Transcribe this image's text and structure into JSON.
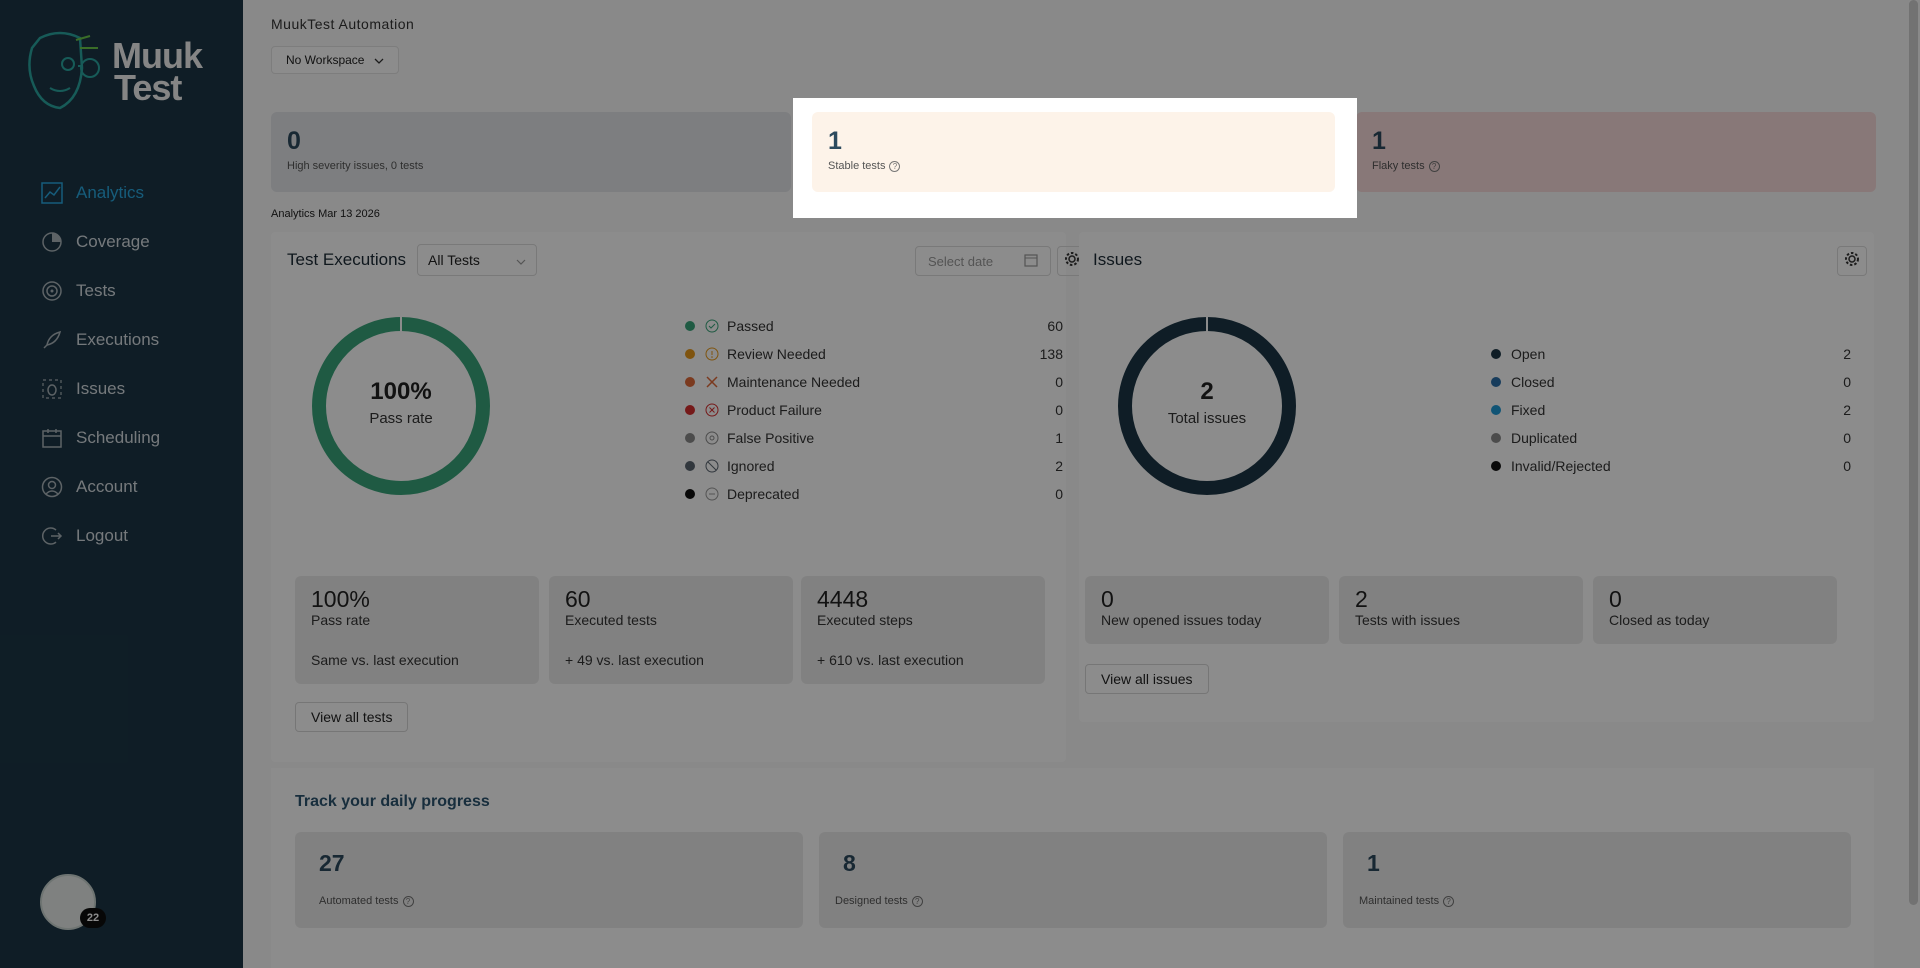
{
  "app": {
    "title": "MuukTest Automation",
    "workspace": "No Workspace"
  },
  "logo": {
    "text_line1": "Muuk",
    "text_line2": "Test"
  },
  "sidebar": {
    "items": [
      {
        "label": "Analytics",
        "icon": "chart-line-icon",
        "active": true
      },
      {
        "label": "Coverage",
        "icon": "coverage-icon"
      },
      {
        "label": "Tests",
        "icon": "target-icon"
      },
      {
        "label": "Executions",
        "icon": "rocket-icon"
      },
      {
        "label": "Issues",
        "icon": "bug-icon"
      },
      {
        "label": "Scheduling",
        "icon": "calendar-icon"
      },
      {
        "label": "Account",
        "icon": "user-icon"
      },
      {
        "label": "Logout",
        "icon": "logout-icon"
      }
    ],
    "avatar_badge": "22"
  },
  "summary": {
    "high": {
      "value": "0",
      "label": "High severity issues, 0 tests"
    },
    "stable": {
      "value": "1",
      "label": "Stable tests"
    },
    "flaky": {
      "value": "1",
      "label": "Flaky tests"
    }
  },
  "analytics_date": "Analytics Mar 13 2026",
  "executions": {
    "title": "Test Executions",
    "filter": "All Tests",
    "date_placeholder": "Select date",
    "donut": {
      "value": "100%",
      "label": "Pass rate",
      "color": "#3aa57a"
    },
    "legend": [
      {
        "label": "Passed",
        "value": "60",
        "color": "#3aa57a",
        "icon": "check-circle-icon"
      },
      {
        "label": "Review Needed",
        "value": "138",
        "color": "#e89a1c",
        "icon": "alert-circle-icon"
      },
      {
        "label": "Maintenance Needed",
        "value": "0",
        "color": "#e06a3a",
        "icon": "tools-icon"
      },
      {
        "label": "Product Failure",
        "value": "0",
        "color": "#d62e2e",
        "icon": "x-circle-icon"
      },
      {
        "label": "False Positive",
        "value": "1",
        "color": "#8a8a8a",
        "icon": "false-positive-icon"
      },
      {
        "label": "Ignored",
        "value": "2",
        "color": "#5a6470",
        "icon": "ban-icon"
      },
      {
        "label": "Deprecated",
        "value": "0",
        "color": "#111111",
        "icon": "minus-circle-icon"
      }
    ],
    "metrics": [
      {
        "value": "100%",
        "label": "Pass rate",
        "delta": "Same vs. last execution"
      },
      {
        "value": "60",
        "label": "Executed tests",
        "delta": "+ 49 vs. last execution"
      },
      {
        "value": "4448",
        "label": "Executed steps",
        "delta": "+ 610 vs. last execution"
      }
    ],
    "view_all": "View all tests"
  },
  "issues": {
    "title": "Issues",
    "donut": {
      "value": "2",
      "label": "Total issues",
      "color": "#1c3645"
    },
    "legend": [
      {
        "label": "Open",
        "value": "2",
        "color": "#1c3645"
      },
      {
        "label": "Closed",
        "value": "0",
        "color": "#2b6ea8"
      },
      {
        "label": "Fixed",
        "value": "2",
        "color": "#1e9ad6"
      },
      {
        "label": "Duplicated",
        "value": "0",
        "color": "#8a8a8a"
      },
      {
        "label": "Invalid/Rejected",
        "value": "0",
        "color": "#111111"
      }
    ],
    "metrics": [
      {
        "value": "0",
        "label": "New opened issues today"
      },
      {
        "value": "2",
        "label": "Tests with issues"
      },
      {
        "value": "0",
        "label": "Closed as today"
      }
    ],
    "view_all": "View all issues"
  },
  "progress": {
    "title": "Track your daily progress",
    "cards": [
      {
        "value": "27",
        "label": "Automated tests"
      },
      {
        "value": "8",
        "label": "Designed tests"
      },
      {
        "value": "1",
        "label": "Maintained tests"
      }
    ]
  }
}
